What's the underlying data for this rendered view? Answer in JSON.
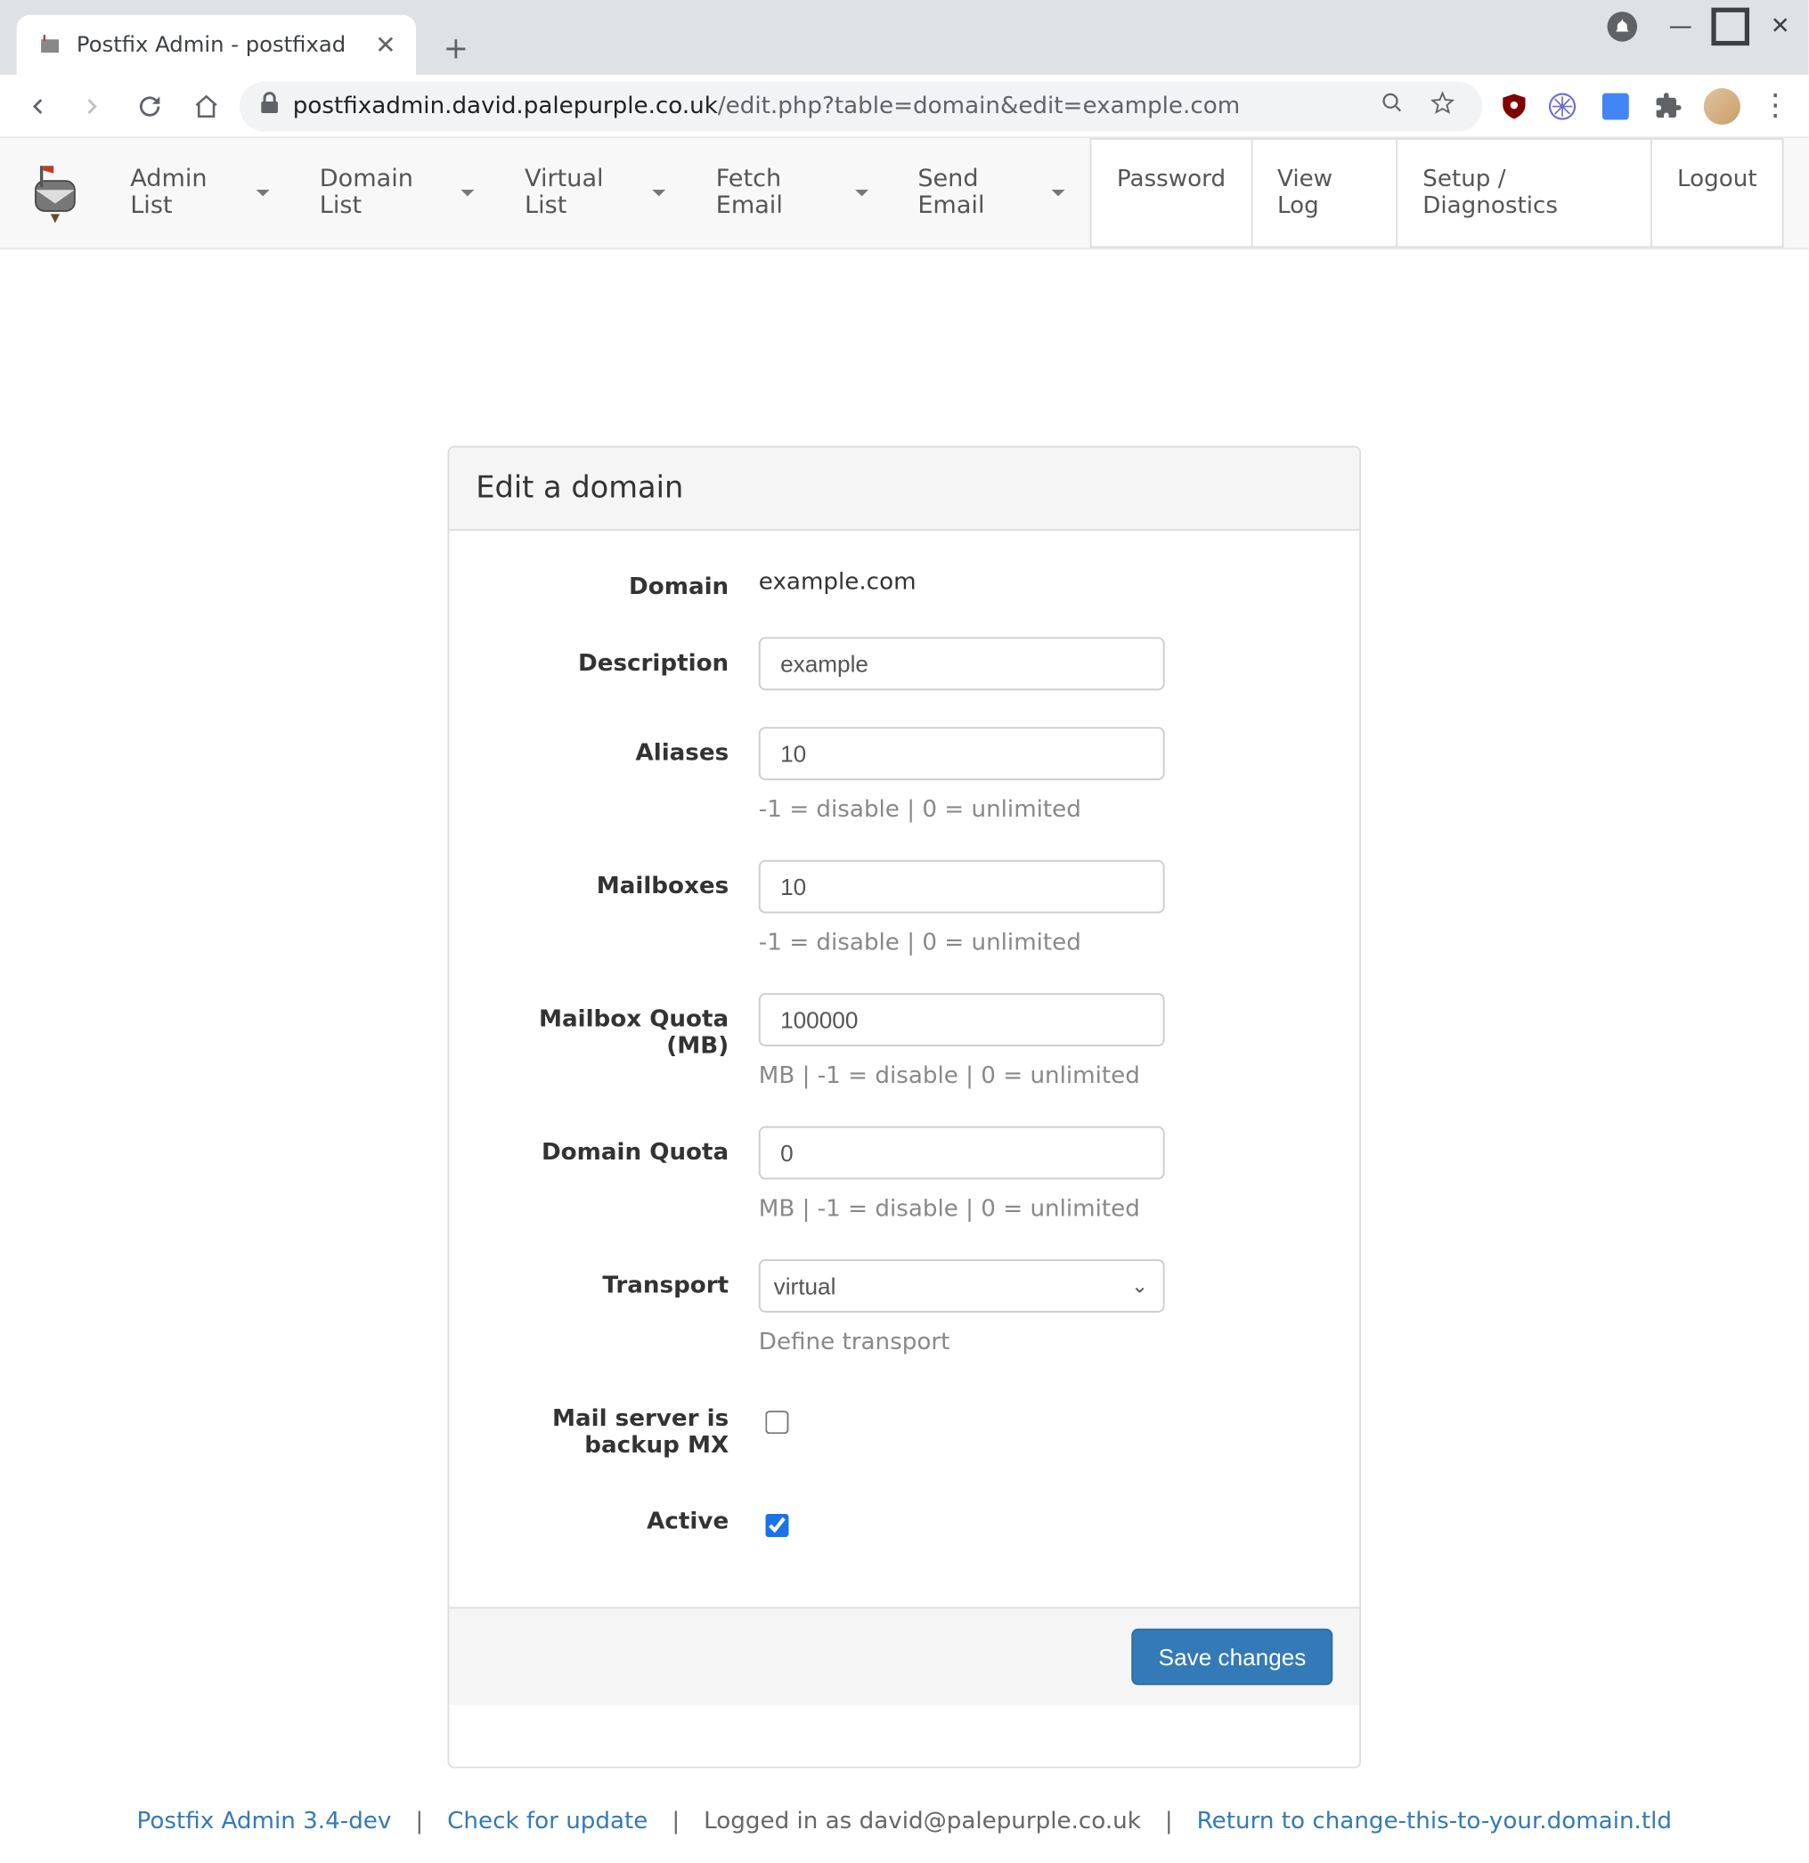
{
  "browser": {
    "tab_title": "Postfix Admin - postfixad",
    "url_host": "postfixadmin.david.palepurple.co.uk",
    "url_path": "/edit.php?table=domain&edit=example.com"
  },
  "nav": {
    "items": [
      "Admin List",
      "Domain List",
      "Virtual List",
      "Fetch Email",
      "Send Email"
    ],
    "right": [
      "Password",
      "View Log",
      "Setup / Diagnostics",
      "Logout"
    ]
  },
  "panel": {
    "title": "Edit a domain",
    "domain_label": "Domain",
    "domain_value": "example.com",
    "description_label": "Description",
    "description_value": "example",
    "aliases_label": "Aliases",
    "aliases_value": "10",
    "aliases_help": "-1 = disable | 0 = unlimited",
    "mailboxes_label": "Mailboxes",
    "mailboxes_value": "10",
    "mailboxes_help": "-1 = disable | 0 = unlimited",
    "mailbox_quota_label": "Mailbox Quota (MB)",
    "mailbox_quota_value": "100000",
    "mailbox_quota_help": "MB | -1 = disable | 0 = unlimited",
    "domain_quota_label": "Domain Quota",
    "domain_quota_value": "0",
    "domain_quota_help": "MB | -1 = disable | 0 = unlimited",
    "transport_label": "Transport",
    "transport_value": "virtual",
    "transport_help": "Define transport",
    "backup_mx_label": "Mail server is backup MX",
    "backup_mx_checked": false,
    "active_label": "Active",
    "active_checked": true,
    "save_label": "Save changes"
  },
  "footer": {
    "app": "Postfix Admin 3.4-dev",
    "check_update": "Check for update",
    "logged_in": "Logged in as david@palepurple.co.uk",
    "return_link": "Return to change-this-to-your.domain.tld",
    "sep": "|"
  }
}
